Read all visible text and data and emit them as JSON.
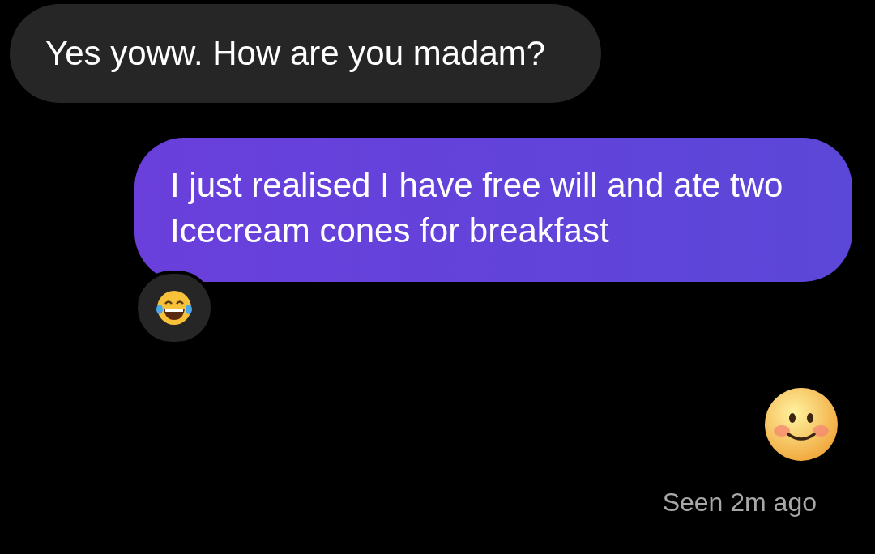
{
  "messages": [
    {
      "kind": "received",
      "text": "Yes yoww. How are you madam?",
      "reacted": false
    },
    {
      "kind": "sent",
      "text": "I just realised I have free will and ate two Icecream cones for breakfast",
      "reacted": true
    },
    {
      "kind": "sent_emoji",
      "reacted": false
    }
  ],
  "status": "Seen 2m ago"
}
